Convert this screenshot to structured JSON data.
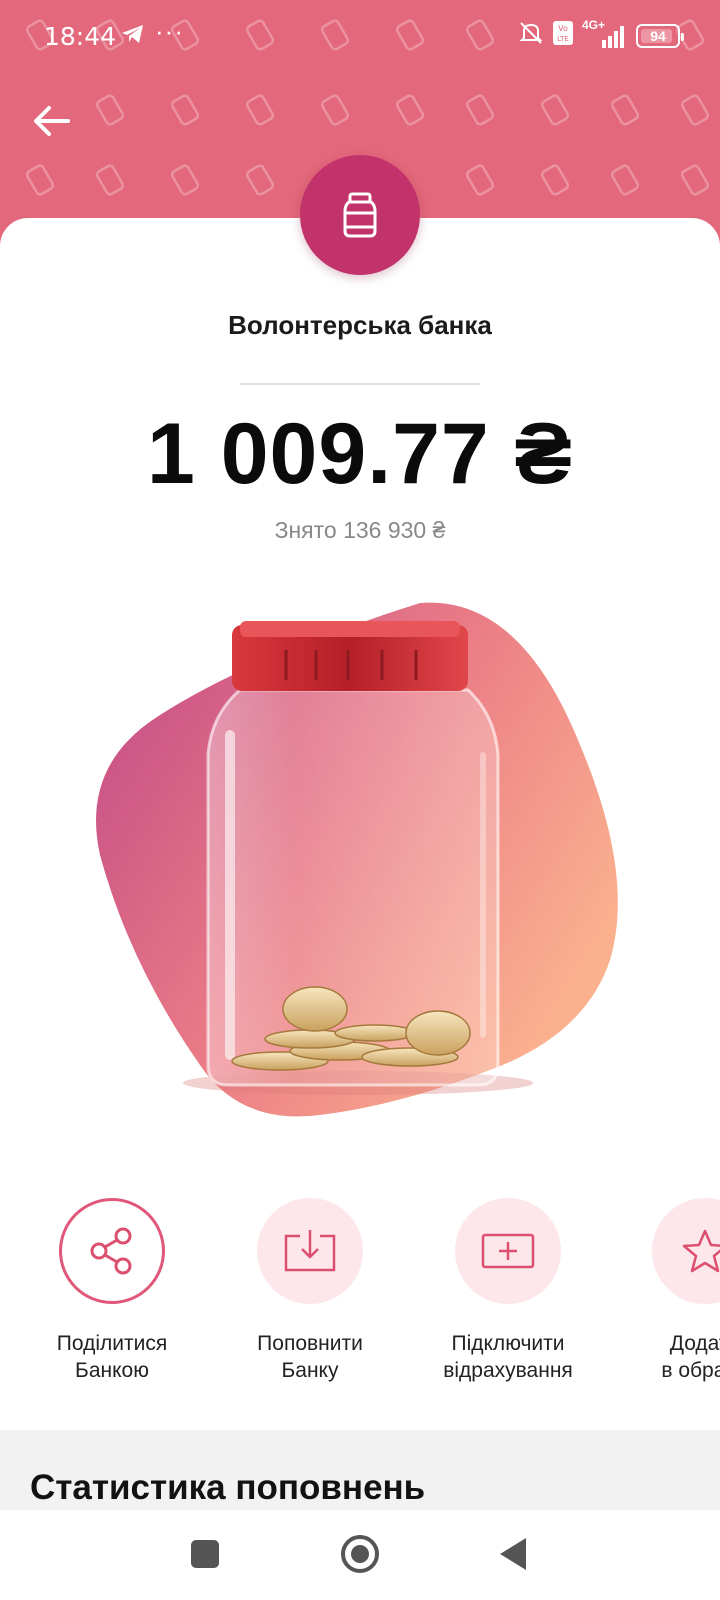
{
  "status_bar": {
    "time": "18:44",
    "dots": "···",
    "network": "4G+",
    "battery": "94",
    "icons": [
      "telegram-icon",
      "mute-icon",
      "volte-icon",
      "signal-icon",
      "battery-icon"
    ]
  },
  "header": {
    "back_icon": "arrow-left-icon",
    "background_color": "#e4687c"
  },
  "jar": {
    "badge_icon": "jar-icon",
    "badge_color": "#c2336b",
    "title": "Волонтерська банка",
    "amount": "1 009.77 ₴",
    "withdrawn": "Знято 136 930 ₴"
  },
  "actions": [
    {
      "label_line1": "Поділитися",
      "label_line2": "Банкою",
      "icon": "share-icon"
    },
    {
      "label_line1": "Поповнити",
      "label_line2": "Банку",
      "icon": "deposit-icon"
    },
    {
      "label_line1": "Підключити",
      "label_line2": "відрахування",
      "icon": "add-card-icon"
    },
    {
      "label_line1": "Додати",
      "label_line2": "в обране",
      "icon": "star-icon"
    }
  ],
  "stats": {
    "heading": "Статистика поповнень"
  },
  "navbar": {
    "icons": [
      "recents-icon",
      "home-icon",
      "back-icon"
    ]
  }
}
